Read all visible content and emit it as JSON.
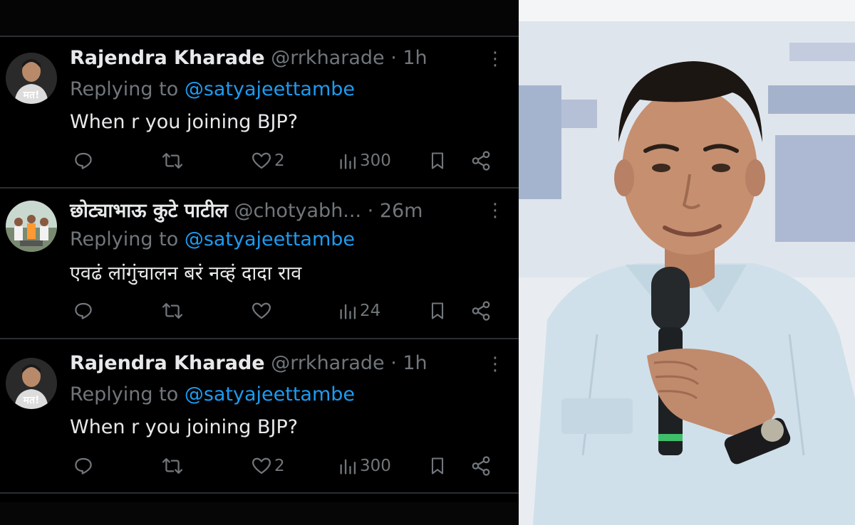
{
  "tweets": [
    {
      "author": "Rajendra Kharade",
      "handle": "@rrkharade",
      "time": "· 1h",
      "replying_prefix": "Replying to ",
      "replying_to": "@satyajeettambe",
      "text": "When r you joining BJP?",
      "avatar_label": "मत!",
      "likes": "2",
      "views": "300"
    },
    {
      "author": "छोट्याभाऊ कुटे पाटील",
      "handle": "@chotyabh...",
      "time": "· 26m",
      "replying_prefix": "Replying to ",
      "replying_to": "@satyajeettambe",
      "text": "एवढं लांगुंचालन बरं नव्हं दादा राव",
      "likes": "",
      "views": "24"
    },
    {
      "author": "Rajendra Kharade",
      "handle": "@rrkharade",
      "time": "· 1h",
      "replying_prefix": "Replying to ",
      "replying_to": "@satyajeettambe",
      "text": "When r you joining BJP?",
      "avatar_label": "मत!",
      "likes": "2",
      "views": "300"
    }
  ],
  "icons": {
    "reply": "speech-bubble-icon",
    "retweet": "retweet-arrows-icon",
    "like": "heart-icon",
    "views": "bar-chart-icon",
    "bookmark": "bookmark-icon",
    "share": "share-nodes-icon",
    "more": "vertical-ellipsis-icon"
  },
  "colors": {
    "background": "#000000",
    "text_primary": "#e7e9ea",
    "text_secondary": "#71767b",
    "link": "#1d9bf0",
    "divider": "#2b2f33"
  }
}
